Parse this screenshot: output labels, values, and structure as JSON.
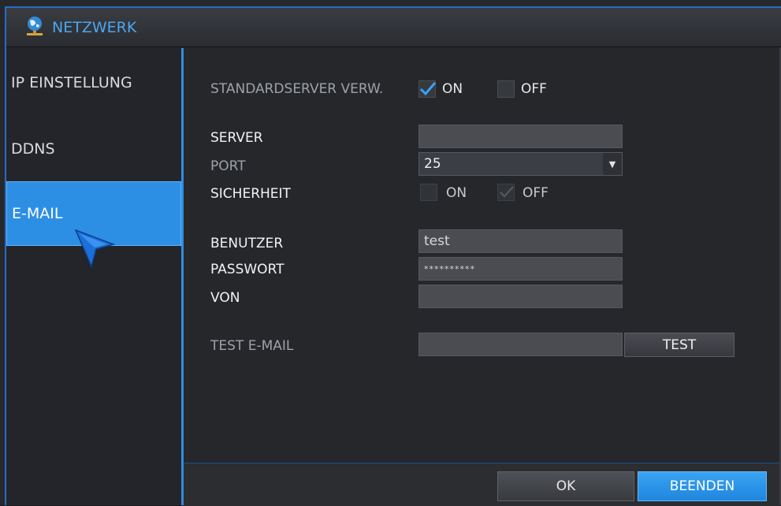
{
  "window": {
    "title": "NETZWERK",
    "icon": "globe-network-icon"
  },
  "sidebar": {
    "items": [
      {
        "label": "IP EINSTELLUNG",
        "active": false
      },
      {
        "label": "DDNS",
        "active": false
      },
      {
        "label": "E-MAIL",
        "active": true
      }
    ]
  },
  "form": {
    "default_server": {
      "label": "STANDARDSERVER VERW.",
      "on_label": "ON",
      "off_label": "OFF",
      "on_checked": true,
      "off_checked": false
    },
    "server": {
      "label": "SERVER",
      "value": ""
    },
    "port": {
      "label": "PORT",
      "value": "25"
    },
    "security": {
      "label": "SICHERHEIT",
      "on_label": "ON",
      "off_label": "OFF",
      "on_checked": false,
      "off_checked": true
    },
    "user": {
      "label": "BENUTZER",
      "value": "test"
    },
    "password": {
      "label": "PASSWORT",
      "value": "**********"
    },
    "from": {
      "label": "VON",
      "value": ""
    },
    "test_email": {
      "label": "TEST E-MAIL",
      "value": "",
      "button": "TEST"
    }
  },
  "footer": {
    "ok_label": "OK",
    "exit_label": "BEENDEN"
  },
  "colors": {
    "accent": "#2d8fe4",
    "title_text": "#4aa6f0",
    "background": "#25272b"
  }
}
